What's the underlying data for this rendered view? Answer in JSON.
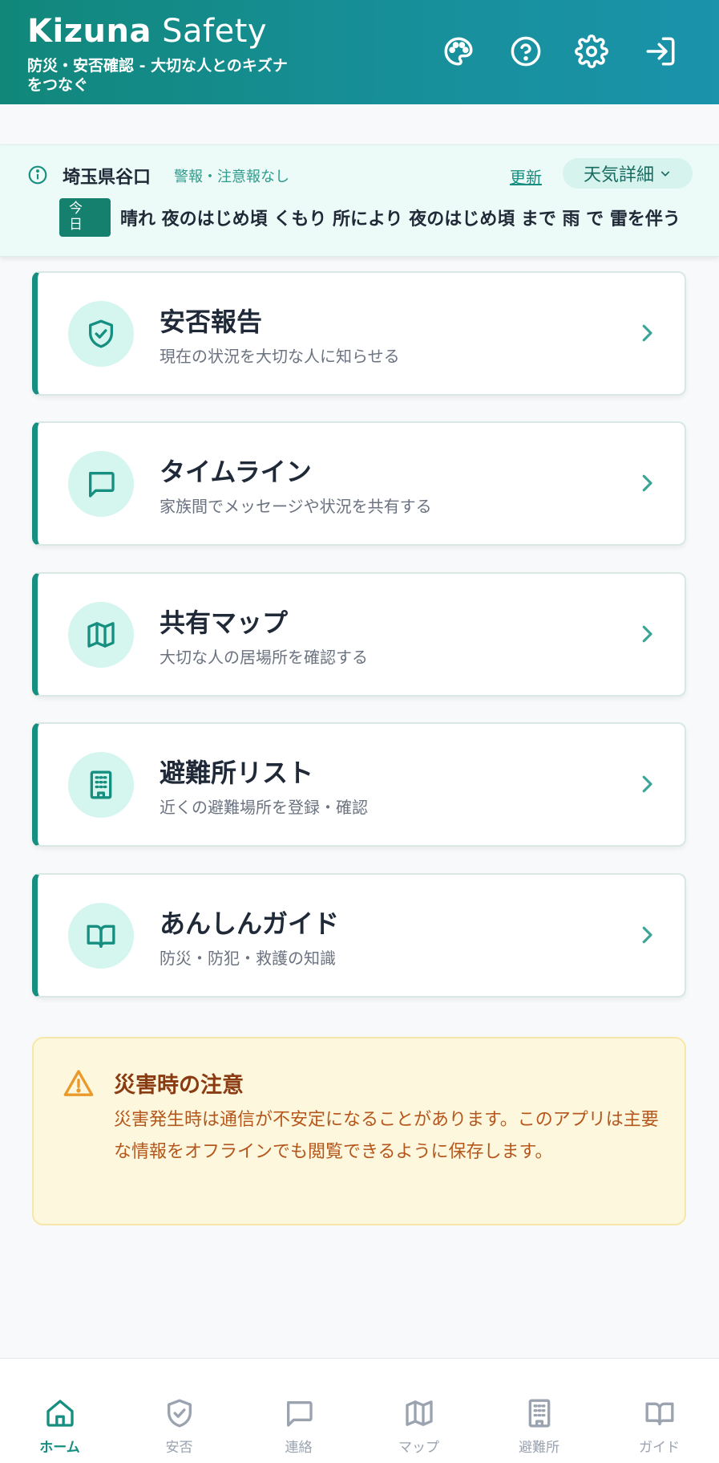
{
  "app": {
    "brand_bold": "Kizuna",
    "brand_light": "Safety",
    "tagline": "防災・安否確認 - 大切な人とのキズナをつなぐ"
  },
  "header_icons": [
    "palette-icon",
    "help-icon",
    "gear-icon",
    "logout-icon"
  ],
  "weather": {
    "location": "埼玉県谷口",
    "warning": "警報・注意報なし",
    "update_label": "更新",
    "detail_label": "天気詳細",
    "today_label_1": "今",
    "today_label_2": "日",
    "forecast": "晴れ 夜のはじめ頃 くもり 所により 夜のはじめ頃 まで 雨 で 雷を伴う"
  },
  "menu": [
    {
      "title": "安否報告",
      "desc": "現在の状況を大切な人に知らせる",
      "icon": "shield-check-icon"
    },
    {
      "title": "タイムライン",
      "desc": "家族間でメッセージや状況を共有する",
      "icon": "chat-icon"
    },
    {
      "title": "共有マップ",
      "desc": "大切な人の居場所を確認する",
      "icon": "map-icon"
    },
    {
      "title": "避難所リスト",
      "desc": "近くの避難場所を登録・確認",
      "icon": "building-icon"
    },
    {
      "title": "あんしんガイド",
      "desc": "防災・防犯・救護の知識",
      "icon": "book-icon"
    }
  ],
  "notice": {
    "title": "災害時の注意",
    "text": "災害発生時は通信が不安定になることがあります。このアプリは主要な情報をオフラインでも閲覧できるように保存します。"
  },
  "nav": [
    {
      "label": "ホーム",
      "icon": "home-icon",
      "active": true
    },
    {
      "label": "安否",
      "icon": "shield-check-icon",
      "active": false
    },
    {
      "label": "連絡",
      "icon": "chat-icon",
      "active": false
    },
    {
      "label": "マップ",
      "icon": "map-icon",
      "active": false
    },
    {
      "label": "避難所",
      "icon": "building-icon",
      "active": false
    },
    {
      "label": "ガイド",
      "icon": "book-icon",
      "active": false
    }
  ],
  "colors": {
    "primary": "#178f80",
    "header_start": "#11877a",
    "header_end": "#1a93ab",
    "warning": "#e99a2b"
  }
}
